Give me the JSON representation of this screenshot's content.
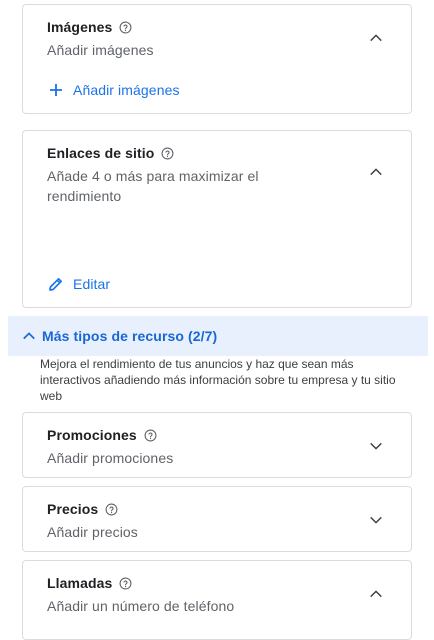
{
  "imagenes": {
    "title": "Imágenes",
    "subtitle": "Añadir imágenes",
    "action_label": "Añadir imágenes",
    "expanded": true
  },
  "enlaces": {
    "title": "Enlaces de sitio",
    "subtitle": "Añade 4 o más para maximizar el rendimiento",
    "action_label": "Editar",
    "expanded": true
  },
  "mas_tipos": {
    "label": "Más tipos de recurso (2/7)",
    "description": "Mejora el rendimiento de tus anuncios y haz que sean más interactivos añadiendo más información sobre tu empresa y tu sitio web",
    "expanded": true
  },
  "promociones": {
    "title": "Promociones",
    "subtitle": "Añadir promociones",
    "expanded": false
  },
  "precios": {
    "title": "Precios",
    "subtitle": "Añadir precios",
    "expanded": false
  },
  "llamadas": {
    "title": "Llamadas",
    "subtitle": "Añadir un número de teléfono",
    "expanded": true
  },
  "colors": {
    "accent": "#1a73e8",
    "section_bg": "#e8f0fe",
    "border": "#dadce0"
  }
}
